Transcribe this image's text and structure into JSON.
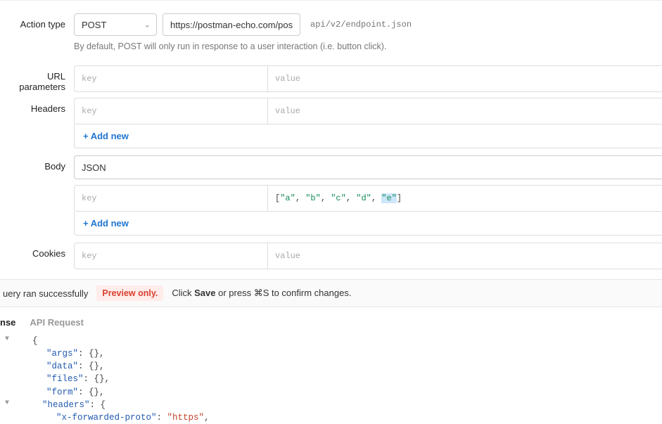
{
  "labels": {
    "action_type": "Action type",
    "url_parameters": "URL parameters",
    "headers": "Headers",
    "body": "Body",
    "cookies": "Cookies"
  },
  "action": {
    "method": "POST",
    "base_url": "https://postman-echo.com/post/",
    "path_placeholder": "api/v2/endpoint.json",
    "hint": "By default, POST will only run in response to a user interaction (i.e. button click)."
  },
  "kv_placeholders": {
    "key": "key",
    "value": "value"
  },
  "add_new_label": "+ Add new",
  "body": {
    "format": "JSON",
    "key_placeholder": "key",
    "value_tokens": [
      "[",
      "\"a\"",
      ", ",
      "\"b\"",
      ", ",
      "\"c\"",
      ", ",
      "\"d\"",
      ", ",
      "\"e\"",
      "]"
    ]
  },
  "status": {
    "success": "uery ran successfully",
    "preview": "Preview only.",
    "save_prefix": "Click ",
    "save_bold": "Save",
    "save_suffix": " or press ⌘S to confirm changes."
  },
  "tabs": {
    "response": "nse",
    "request": "API Request"
  },
  "response_json": {
    "l1": "{",
    "l2_k": "\"args\"",
    "l2_v": "{}",
    "l3_k": "\"data\"",
    "l3_v": "{}",
    "l4_k": "\"files\"",
    "l4_v": "{}",
    "l5_k": "\"form\"",
    "l5_v": "{}",
    "l6_k": "\"headers\"",
    "l6_v": "{",
    "l7_k": "\"x-forwarded-proto\"",
    "l7_v": "\"https\""
  }
}
